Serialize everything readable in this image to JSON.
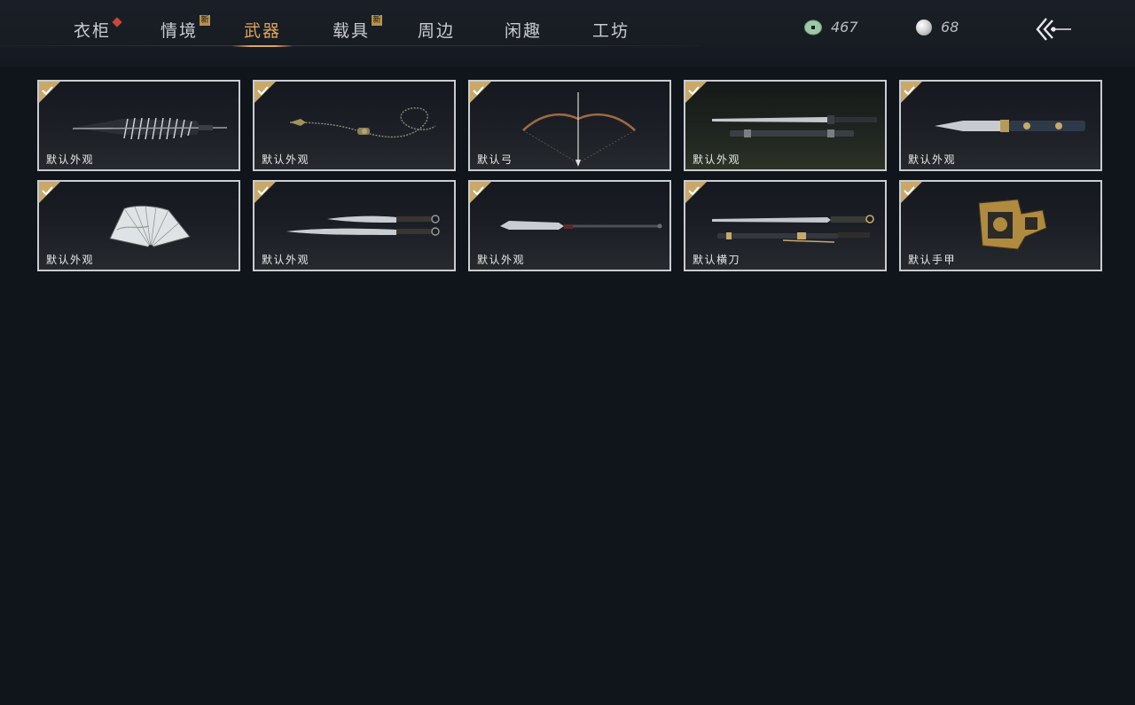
{
  "tabs": [
    {
      "label": "衣柜",
      "badge": "diamond",
      "active": false
    },
    {
      "label": "情境",
      "badge": "新",
      "active": false
    },
    {
      "label": "武器",
      "badge": "",
      "active": true
    },
    {
      "label": "载具",
      "badge": "新",
      "active": false
    },
    {
      "label": "周边",
      "badge": "",
      "active": false
    },
    {
      "label": "闲趣",
      "badge": "",
      "active": false
    },
    {
      "label": "工坊",
      "badge": "",
      "active": false
    }
  ],
  "currency": {
    "jade": {
      "icon": "jade-coin-icon",
      "amount": "467"
    },
    "pearl": {
      "icon": "pearl-icon",
      "amount": "68"
    }
  },
  "back_button": {
    "icon": "back-arrow-icon"
  },
  "items": [
    {
      "label": "默认外观",
      "art": "umbrella",
      "selected": true
    },
    {
      "label": "默认外观",
      "art": "rope-dart",
      "selected": true
    },
    {
      "label": "默认弓",
      "art": "bow",
      "selected": true
    },
    {
      "label": "默认外观",
      "art": "sword",
      "selected": true
    },
    {
      "label": "默认外观",
      "art": "blade",
      "selected": true
    },
    {
      "label": "默认外观",
      "art": "fan",
      "selected": true
    },
    {
      "label": "默认外观",
      "art": "dual-blades",
      "selected": true
    },
    {
      "label": "默认外观",
      "art": "spear",
      "selected": true
    },
    {
      "label": "默认横刀",
      "art": "hengdao",
      "selected": true
    },
    {
      "label": "默认手甲",
      "art": "gauntlet",
      "selected": true
    }
  ],
  "colors": {
    "accent": "#e2a458",
    "badge_red": "#c8483a",
    "check_gold": "#c9a86a",
    "background": "#10141b"
  }
}
